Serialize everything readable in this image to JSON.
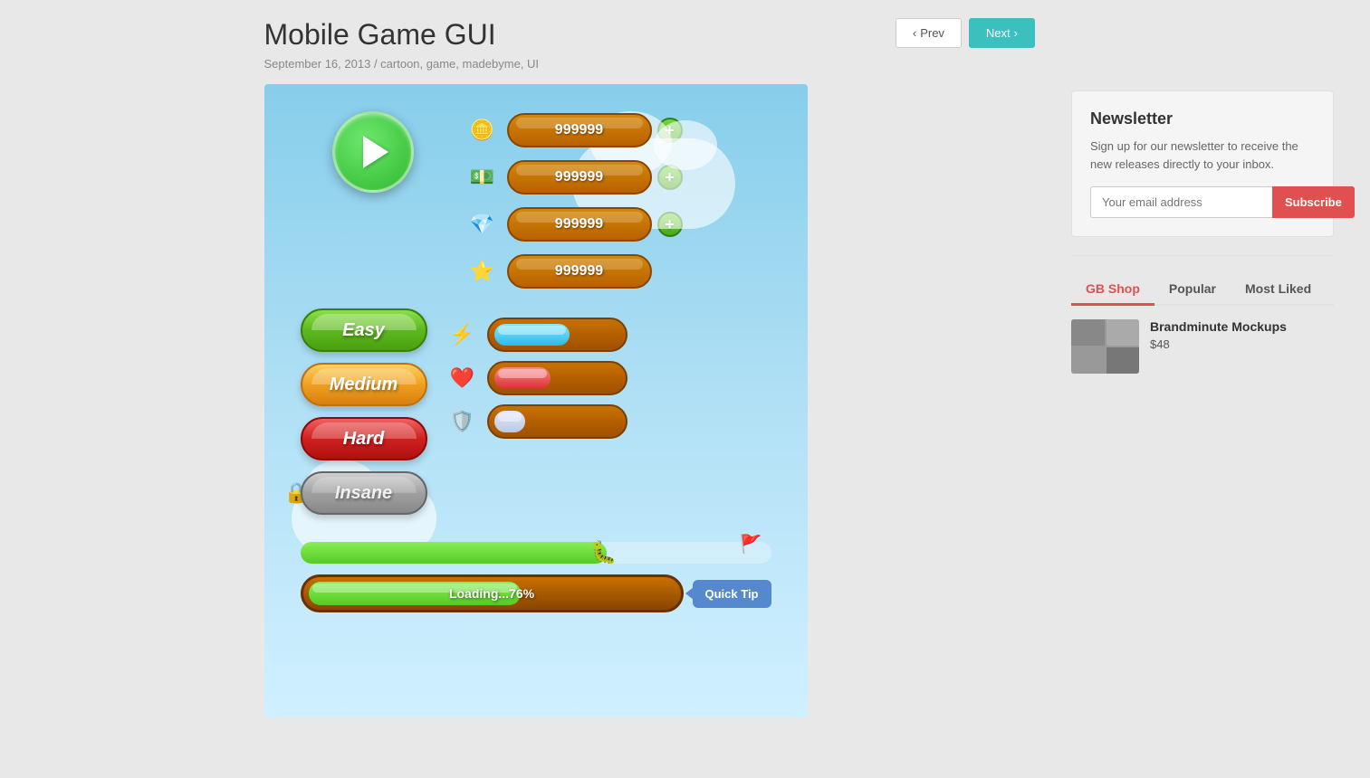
{
  "header": {
    "title": "Mobile Game GUI",
    "date": "September 16, 2013",
    "separator": "/",
    "tags": "cartoon, game, madebyme, UI",
    "prev_label": "Prev",
    "next_label": "Next"
  },
  "game": {
    "play_button_label": "Play",
    "difficulty_buttons": [
      {
        "id": "easy",
        "label": "Easy",
        "locked": false
      },
      {
        "id": "medium",
        "label": "Medium",
        "locked": false
      },
      {
        "id": "hard",
        "label": "Hard",
        "locked": false
      },
      {
        "id": "insane",
        "label": "Insane",
        "locked": true
      }
    ],
    "resources": [
      {
        "id": "coins",
        "icon": "🪙",
        "value": "999999",
        "has_plus": true
      },
      {
        "id": "cash",
        "icon": "💵",
        "value": "999999",
        "has_plus": true
      },
      {
        "id": "gems",
        "icon": "💎",
        "value": "999999",
        "has_plus": true
      },
      {
        "id": "stars",
        "icon": "⭐",
        "value": "999999",
        "has_plus": false
      }
    ],
    "progress_bars": [
      {
        "id": "energy",
        "icon": "⚡",
        "color": "energy",
        "percent": 60
      },
      {
        "id": "health",
        "icon": "❤️",
        "color": "health",
        "percent": 45
      },
      {
        "id": "shield",
        "icon": "🛡️",
        "color": "shield",
        "percent": 25
      }
    ],
    "loading": {
      "text": "Loading...76%",
      "percent": 76,
      "quick_tip_label": "Quick Tip"
    }
  },
  "newsletter": {
    "title": "Newsletter",
    "description": "Sign up for our newsletter to receive the new releases directly to your inbox.",
    "email_placeholder": "Your email address",
    "subscribe_label": "Subscribe"
  },
  "tabs": [
    {
      "id": "gb-shop",
      "label": "GB Shop",
      "active": true
    },
    {
      "id": "popular",
      "label": "Popular",
      "active": false
    },
    {
      "id": "most-liked",
      "label": "Most Liked",
      "active": false
    }
  ],
  "shop_items": [
    {
      "id": "brandminute",
      "name": "Brandminute Mockups",
      "price": "$48"
    }
  ]
}
